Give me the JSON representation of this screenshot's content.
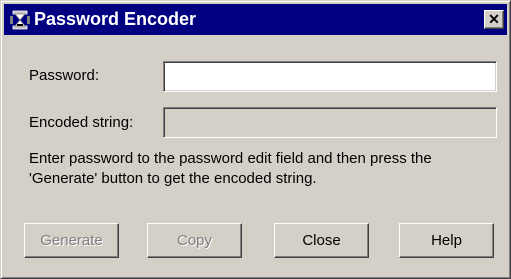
{
  "window": {
    "title": "Password Encoder",
    "close_glyph": "✕"
  },
  "form": {
    "password_label": "Password:",
    "password_value": "",
    "encoded_label": "Encoded string:",
    "encoded_value": ""
  },
  "instructions": "Enter password to the password edit field and then press the 'Generate' button to get the encoded string.",
  "buttons": {
    "generate": "Generate",
    "copy": "Copy",
    "close": "Close",
    "help": "Help"
  },
  "state": {
    "generate_enabled": false,
    "copy_enabled": false
  },
  "colors": {
    "titlebar": "#000080",
    "face": "#d4d0c8",
    "disabled_text": "#808080"
  },
  "icons": {
    "app": "app-hourglass-icon",
    "close": "close-icon"
  }
}
